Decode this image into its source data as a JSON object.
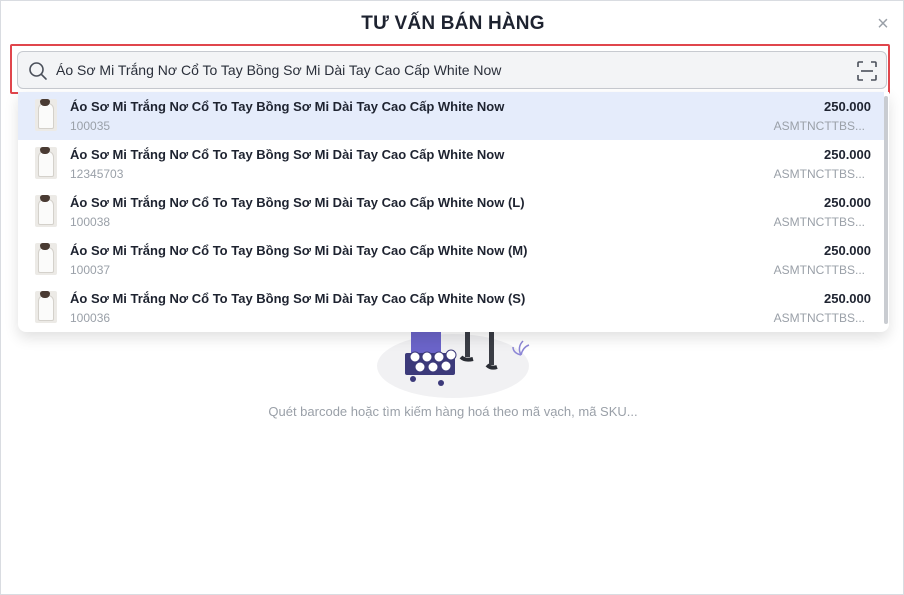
{
  "modal": {
    "title": "TƯ VẤN BÁN HÀNG",
    "close_icon": "close-icon",
    "close_glyph": "×"
  },
  "search": {
    "value": "Áo Sơ Mi Trắng Nơ Cổ To Tay Bồng Sơ Mi Dài Tay Cao Cấp White Now",
    "icon": "search-icon",
    "scan_icon": "barcode-scan-icon"
  },
  "results": [
    {
      "name": "Áo Sơ Mi Trắng Nơ Cổ To Tay Bồng Sơ Mi Dài Tay Cao Cấp White Now",
      "code": "100035",
      "price": "250.000",
      "sku": "ASMTNCTTBS...",
      "active": true
    },
    {
      "name": "Áo Sơ Mi Trắng Nơ Cổ To Tay Bồng Sơ Mi Dài Tay Cao Cấp White Now",
      "code": "12345703",
      "price": "250.000",
      "sku": "ASMTNCTTBS...",
      "active": false
    },
    {
      "name": "Áo Sơ Mi Trắng Nơ Cổ To Tay Bồng Sơ Mi Dài Tay Cao Cấp White Now (L)",
      "code": "100038",
      "price": "250.000",
      "sku": "ASMTNCTTBS...",
      "active": false
    },
    {
      "name": "Áo Sơ Mi Trắng Nơ Cổ To Tay Bồng Sơ Mi Dài Tay Cao Cấp White Now (M)",
      "code": "100037",
      "price": "250.000",
      "sku": "ASMTNCTTBS...",
      "active": false
    },
    {
      "name": "Áo Sơ Mi Trắng Nơ Cổ To Tay Bồng Sơ Mi Dài Tay Cao Cấp White Now (S)",
      "code": "100036",
      "price": "250.000",
      "sku": "ASMTNCTTBS...",
      "active": false
    }
  ],
  "empty_state": {
    "text": "Quét barcode hoặc tìm kiếm hàng hoá theo mã vạch, mã SKU..."
  },
  "colors": {
    "highlight_border": "#e0464c",
    "active_row": "#e5ecfb",
    "title_text": "#1e2330",
    "muted_text": "#9aa0a8"
  }
}
